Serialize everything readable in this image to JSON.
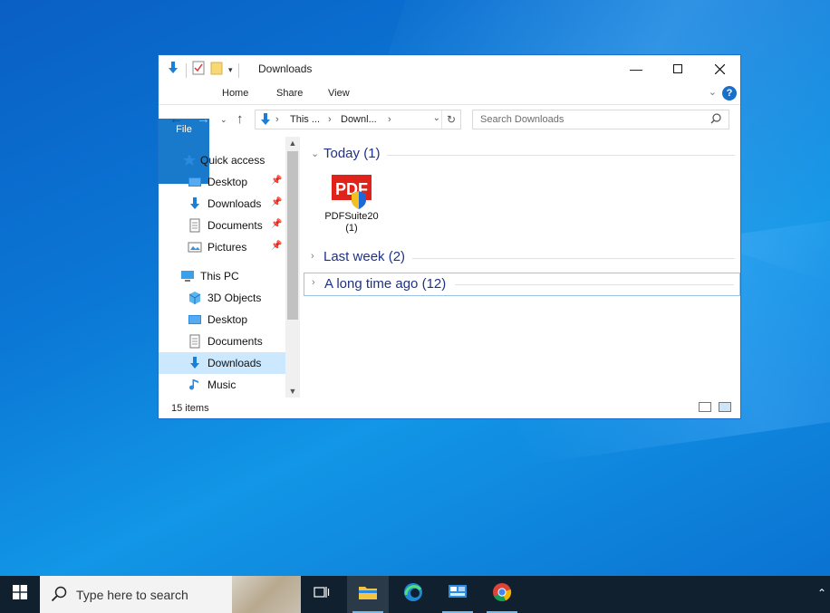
{
  "window": {
    "title": "Downloads",
    "ribbon_tabs": [
      "File",
      "Home",
      "Share",
      "View"
    ],
    "help": "?",
    "address": {
      "crumbs": [
        "This ...",
        "Downl..."
      ]
    },
    "search_placeholder": "Search Downloads"
  },
  "nav": {
    "quick_access": "Quick access",
    "quick_items": [
      "Desktop",
      "Downloads",
      "Documents",
      "Pictures"
    ],
    "this_pc": "This PC",
    "pc_items": [
      "3D Objects",
      "Desktop",
      "Documents",
      "Downloads",
      "Music"
    ],
    "selected": "Downloads"
  },
  "content": {
    "groups": [
      {
        "label": "Today (1)",
        "expanded": true
      },
      {
        "label": "Last week (2)",
        "expanded": false
      },
      {
        "label": "A long time ago (12)",
        "expanded": false
      }
    ],
    "file": {
      "name_line1": "PDFSuite20",
      "name_line2": "(1)",
      "icon_text": "PDF"
    }
  },
  "status": {
    "items": "15 items"
  },
  "taskbar": {
    "search_placeholder": "Type here to search"
  },
  "colors": {
    "accent": "#1979ca",
    "group_heading": "#1e3287",
    "selection": "#cce8ff",
    "taskbar": "#10202f"
  }
}
